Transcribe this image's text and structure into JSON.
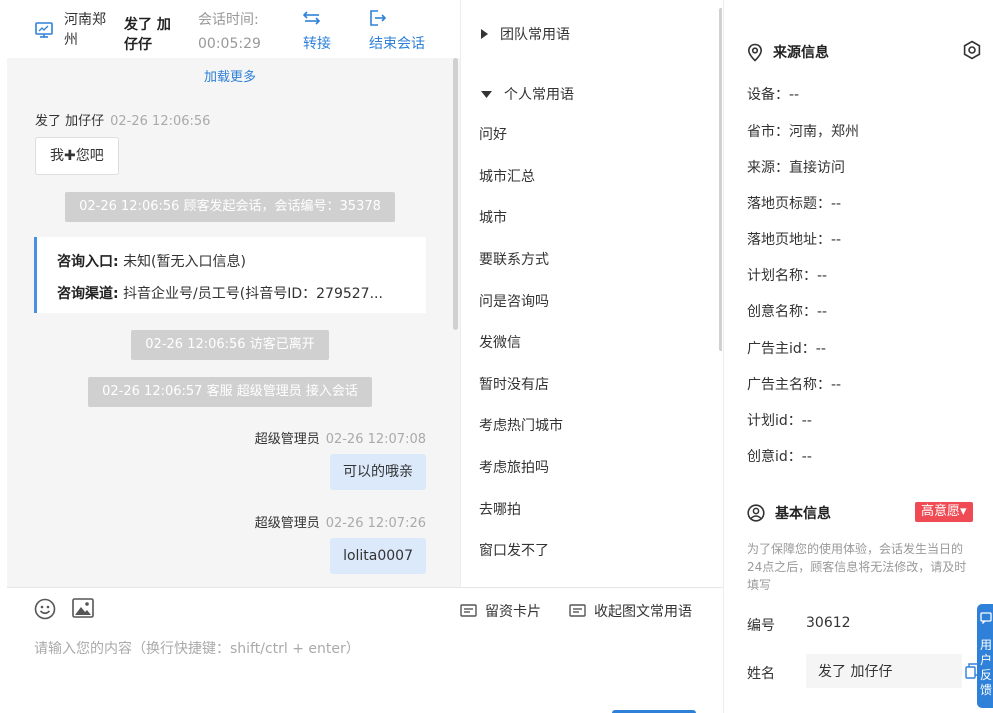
{
  "header": {
    "location": "河南郑州",
    "visitor": "发了 加仔仔",
    "session_label": "会话时间:",
    "session_time": "00:05:29",
    "transfer_label": "转接",
    "end_label": "结束会话"
  },
  "chat": {
    "load_more": "加载更多",
    "messages": [
      {
        "sender": "发了 加仔仔",
        "time": "02-26 12:06:56",
        "text": "我✚您吧"
      },
      {
        "system": "02-26 12:06:56 顾客发起会话，会话编号：35378"
      },
      {
        "system": "02-26 12:06:56 访客已离开"
      },
      {
        "system": "02-26 12:06:57 客服 超级管理员 接入会话"
      },
      {
        "sender": "超级管理员",
        "time": "02-26 12:07:08",
        "text": "可以的哦亲"
      },
      {
        "sender": "超级管理员",
        "time": "02-26 12:07:26",
        "text": "lolita0007"
      }
    ],
    "entry_label": "咨询入口:",
    "entry_value": "未知(暂无入口信息)",
    "channel_label": "咨询渠道:",
    "channel_value": "抖音企业号/员工号(抖音号ID：279527..."
  },
  "input": {
    "placeholder": "请输入您的内容（换行快捷键：shift/ctrl + enter）",
    "card_label": "留资卡片",
    "collapse_label": "收起图文常用语"
  },
  "phrases": {
    "team_group": "团队常用语",
    "personal_group": "个人常用语",
    "items": [
      "问好",
      "城市汇总",
      "城市",
      "要联系方式",
      "问是咨询吗",
      "发微信",
      "暂时没有店",
      "考虑热门城市",
      "考虑旅拍吗",
      "去哪拍",
      "窗口发不了"
    ]
  },
  "source_info": {
    "title": "来源信息",
    "fields": [
      "设备：--",
      "省市：河南，郑州",
      "来源：直接访问",
      "落地页标题：--",
      "落地页地址：--",
      "计划名称：--",
      "创意名称：--",
      "广告主id：--",
      "广告主名称：--",
      "计划id：--",
      "创意id：--"
    ]
  },
  "basic_info": {
    "title": "基本信息",
    "intent_badge": "高意愿▾",
    "notice": "为了保障您的使用体验，会话发生当日的24点之后，顾客信息将无法修改，请及时填写",
    "id_label": "编号",
    "id_value": "30612",
    "name_label": "姓名",
    "name_value": "发了 加仔仔"
  },
  "feedback": {
    "label": "用户反馈"
  },
  "colors": {
    "accent": "#2f80d8",
    "badge": "#f04b54",
    "out_bubble": "#dbe9fb"
  }
}
